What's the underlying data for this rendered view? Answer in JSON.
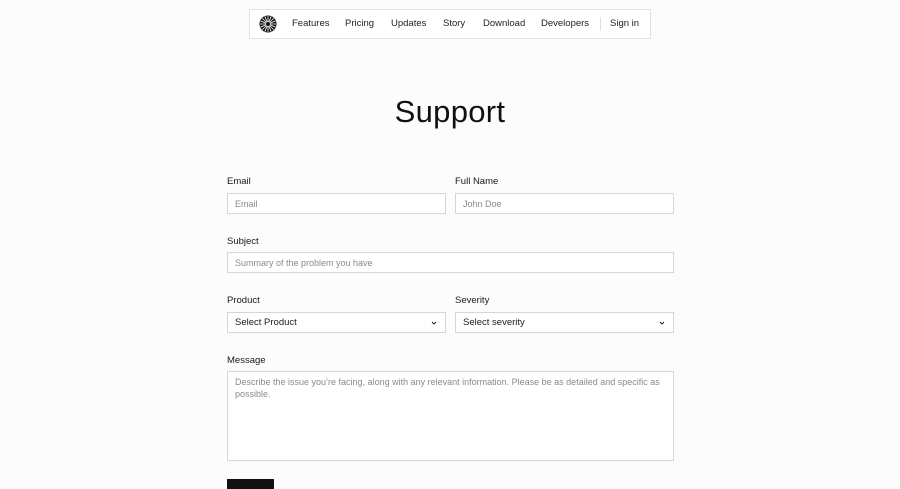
{
  "nav": {
    "items": [
      {
        "label": "Features"
      },
      {
        "label": "Pricing"
      },
      {
        "label": "Updates"
      },
      {
        "label": "Story"
      },
      {
        "label": "Download"
      },
      {
        "label": "Developers"
      }
    ],
    "sign_in": "Sign in",
    "logo_icon": "sunburst-logo-icon"
  },
  "page": {
    "title": "Support"
  },
  "form": {
    "email": {
      "label": "Email",
      "placeholder": "Email"
    },
    "full_name": {
      "label": "Full Name",
      "placeholder": "John Doe"
    },
    "subject": {
      "label": "Subject",
      "placeholder": "Summary of the problem you have"
    },
    "product": {
      "label": "Product",
      "value": "Select Product"
    },
    "severity": {
      "label": "Severity",
      "value": "Select severity"
    },
    "message": {
      "label": "Message",
      "placeholder": "Describe the issue you’re facing, along with any relevant information. Please be as detailed and specific as possible."
    }
  },
  "colors": {
    "background": "#fcfcfc",
    "border": "#d6d6d6",
    "text": "#111111",
    "placeholder": "#8a8a8a"
  }
}
